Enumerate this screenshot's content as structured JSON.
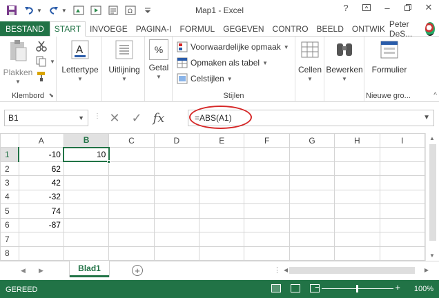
{
  "window": {
    "title": "Map1 - Excel",
    "controls": [
      "?",
      "minimize",
      "restore",
      "close"
    ]
  },
  "quick_access": [
    "save-icon",
    "undo-icon",
    "redo-icon",
    "screenshot-icon",
    "macro-icon",
    "form-icon",
    "symbol-icon",
    "customize-icon"
  ],
  "tabs": [
    {
      "label": "BESTAND",
      "type": "file"
    },
    {
      "label": "START",
      "type": "active"
    },
    {
      "label": "INVOEGE",
      "type": "normal"
    },
    {
      "label": "PAGINA-I",
      "type": "normal"
    },
    {
      "label": "FORMUL",
      "type": "normal"
    },
    {
      "label": "GEGEVEN",
      "type": "normal"
    },
    {
      "label": "CONTRO",
      "type": "normal"
    },
    {
      "label": "BEELD",
      "type": "normal"
    },
    {
      "label": "ONTWIK",
      "type": "normal"
    }
  ],
  "user": {
    "name": "Peter DeS..."
  },
  "ribbon": {
    "clipboard": {
      "paste": "Plakken",
      "group": "Klembord"
    },
    "font": {
      "label": "Lettertype"
    },
    "alignment": {
      "label": "Uitlijning"
    },
    "number": {
      "label": "Getal",
      "symbol": "%"
    },
    "styles": {
      "conditional": "Voorwaardelijke opmaak",
      "table": "Opmaken als tabel",
      "cellstyles": "Celstijlen",
      "group": "Stijlen"
    },
    "cells": {
      "label": "Cellen"
    },
    "editing": {
      "label": "Bewerken"
    },
    "newgroup": {
      "label": "Formulier",
      "group": "Nieuwe gro..."
    }
  },
  "formula_bar": {
    "name_box": "B1",
    "formula": "=ABS(A1)",
    "fx": "fx"
  },
  "sheet": {
    "columns": [
      "A",
      "B",
      "C",
      "D",
      "E",
      "F",
      "G",
      "H",
      "I"
    ],
    "selected_column": "B",
    "rows": [
      {
        "n": "1",
        "cells": [
          "-10",
          "10",
          "",
          "",
          "",
          "",
          "",
          "",
          ""
        ]
      },
      {
        "n": "2",
        "cells": [
          "62",
          "",
          "",
          "",
          "",
          "",
          "",
          "",
          ""
        ]
      },
      {
        "n": "3",
        "cells": [
          "42",
          "",
          "",
          "",
          "",
          "",
          "",
          "",
          ""
        ]
      },
      {
        "n": "4",
        "cells": [
          "-32",
          "",
          "",
          "",
          "",
          "",
          "",
          "",
          ""
        ]
      },
      {
        "n": "5",
        "cells": [
          "74",
          "",
          "",
          "",
          "",
          "",
          "",
          "",
          ""
        ]
      },
      {
        "n": "6",
        "cells": [
          "-87",
          "",
          "",
          "",
          "",
          "",
          "",
          "",
          ""
        ]
      },
      {
        "n": "7",
        "cells": [
          "",
          "",
          "",
          "",
          "",
          "",
          "",
          "",
          ""
        ]
      },
      {
        "n": "8",
        "cells": [
          "",
          "",
          "",
          "",
          "",
          "",
          "",
          "",
          ""
        ]
      }
    ],
    "tab": "Blad1",
    "add_symbol": "+"
  },
  "status": {
    "text": "GEREED",
    "zoom_minus": "−",
    "zoom_plus": "+",
    "zoom": "100%"
  },
  "colors": {
    "accent": "#217346",
    "highlight": "#d62828"
  }
}
